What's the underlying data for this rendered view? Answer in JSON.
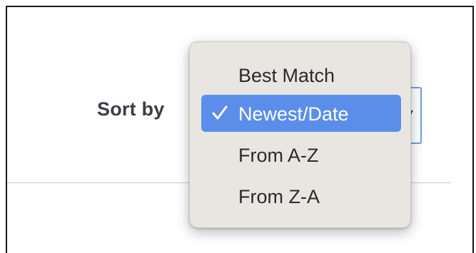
{
  "sort": {
    "label": "Sort by"
  },
  "dropdown": {
    "selected_value": "Newest/Date",
    "options": [
      {
        "label": "Best Match",
        "selected": false
      },
      {
        "label": "Newest/Date",
        "selected": true
      },
      {
        "label": "From A-Z",
        "selected": false
      },
      {
        "label": "From Z-A",
        "selected": false
      }
    ],
    "check_icon": "checkmark-icon",
    "chevron_icon": "chevron-down-icon"
  },
  "colors": {
    "highlight": "#5b8eea",
    "menu_background": "#e9e6e1",
    "select_focus_border": "#6a9fe0",
    "label_text": "#3a3f45"
  }
}
